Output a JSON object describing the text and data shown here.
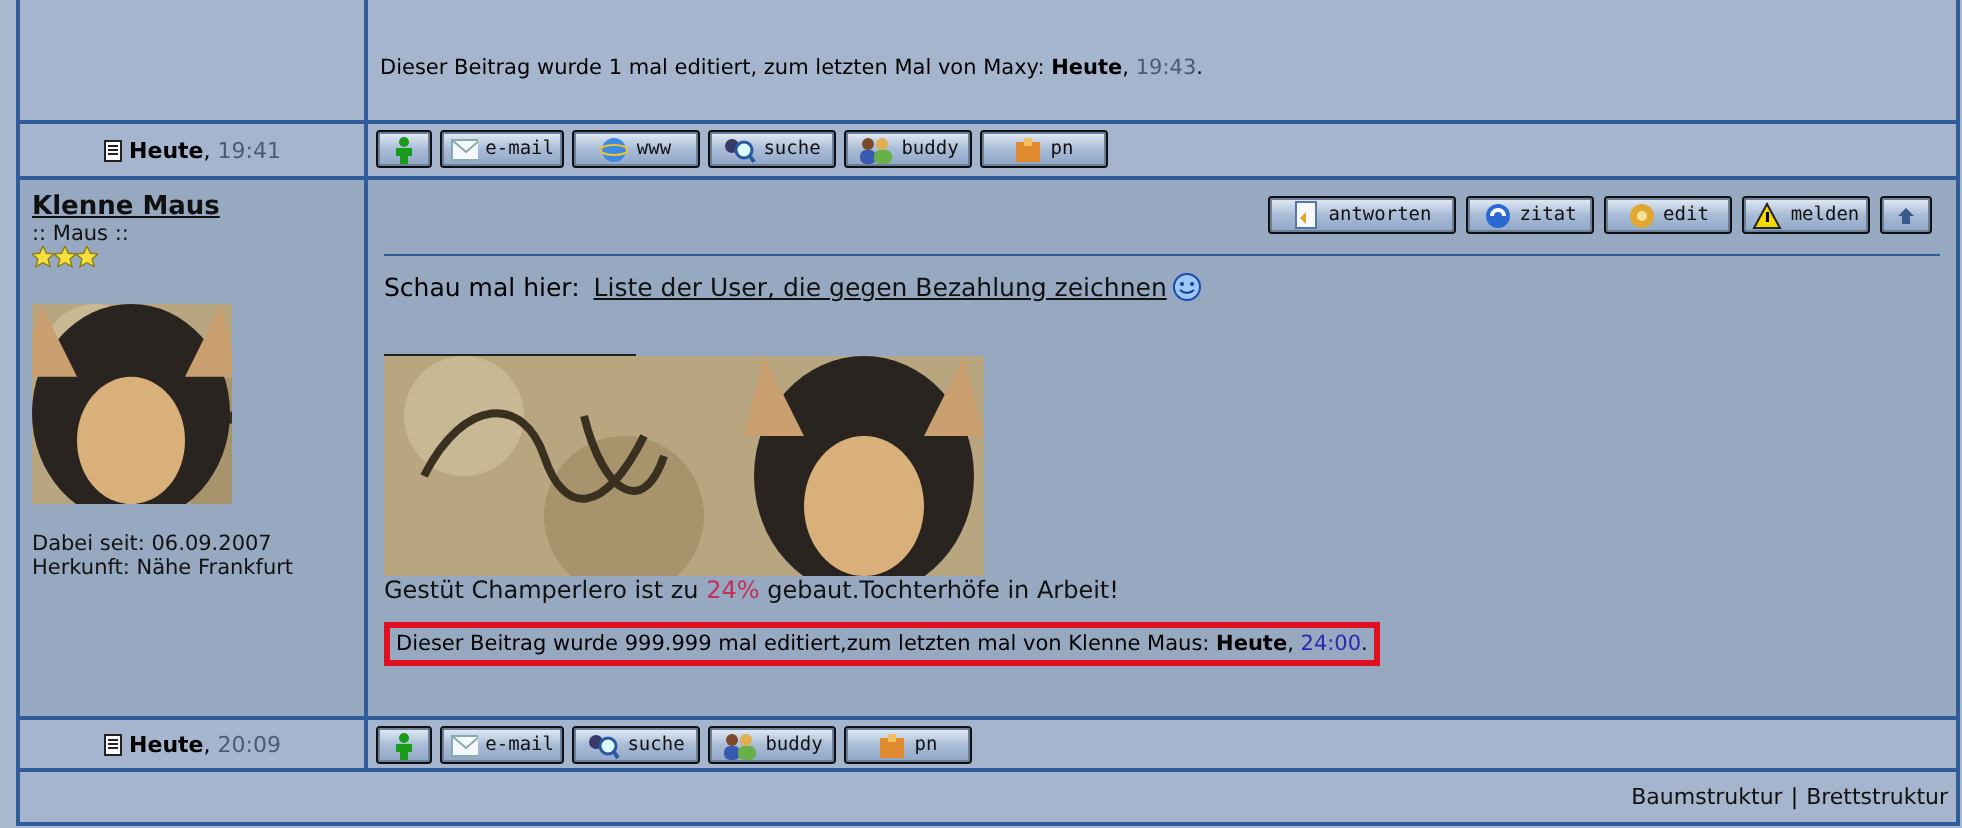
{
  "previous_post": {
    "edit_note": {
      "text": "Dieser Beitrag wurde 1 mal editiert, zum letzten Mal von Maxy: ",
      "day": "Heute",
      "sep": ",",
      "time": "19:43",
      "end": "."
    },
    "footer": {
      "day": "Heute",
      "sep": ",",
      "time": "19:41",
      "buttons": [
        {
          "kind": "profile"
        },
        {
          "kind": "email",
          "label": "e-mail"
        },
        {
          "kind": "www",
          "label": "www"
        },
        {
          "kind": "search",
          "label": "suche"
        },
        {
          "kind": "buddy",
          "label": "buddy"
        },
        {
          "kind": "pm",
          "label": "pn"
        }
      ]
    }
  },
  "post": {
    "author": {
      "name": "Klenne Maus",
      "rank": ":: Maus ::",
      "stars": 3,
      "joined": "Dabei seit: 06.09.2007",
      "origin": "Herkunft: Nähe Frankfurt"
    },
    "actions": [
      {
        "kind": "reply",
        "label": "antworten"
      },
      {
        "kind": "quote",
        "label": "zitat"
      },
      {
        "kind": "edit",
        "label": "edit"
      },
      {
        "kind": "report",
        "label": "melden"
      },
      {
        "kind": "top"
      }
    ],
    "message": {
      "text": "Schau mal hier: ",
      "link": "Liste der User, die gegen Bezahlung zeichnen",
      "smiley": true
    },
    "signature": {
      "text": "Gestüt Champerlero ist zu ",
      "percent": "24%",
      "rest": " gebaut.Tochterhöfe in Arbeit!"
    },
    "edit_note": {
      "highlighted": true,
      "text": "Dieser Beitrag wurde 999.999 mal editiert,zum letzten mal von Klenne Maus: ",
      "day": "Heute",
      "sep": ",",
      "time": "24:00",
      "end": "."
    },
    "footer": {
      "day": "Heute",
      "sep": ",",
      "time": "20:09",
      "buttons": [
        {
          "kind": "profile"
        },
        {
          "kind": "email",
          "label": "e-mail"
        },
        {
          "kind": "search",
          "label": "suche"
        },
        {
          "kind": "buddy",
          "label": "buddy"
        },
        {
          "kind": "pm",
          "label": "pn"
        }
      ]
    }
  },
  "bottom_links": [
    {
      "label": "Baumstruktur"
    },
    {
      "label": "|",
      "kind": "separator"
    },
    {
      "label": "Brettstruktur"
    }
  ]
}
